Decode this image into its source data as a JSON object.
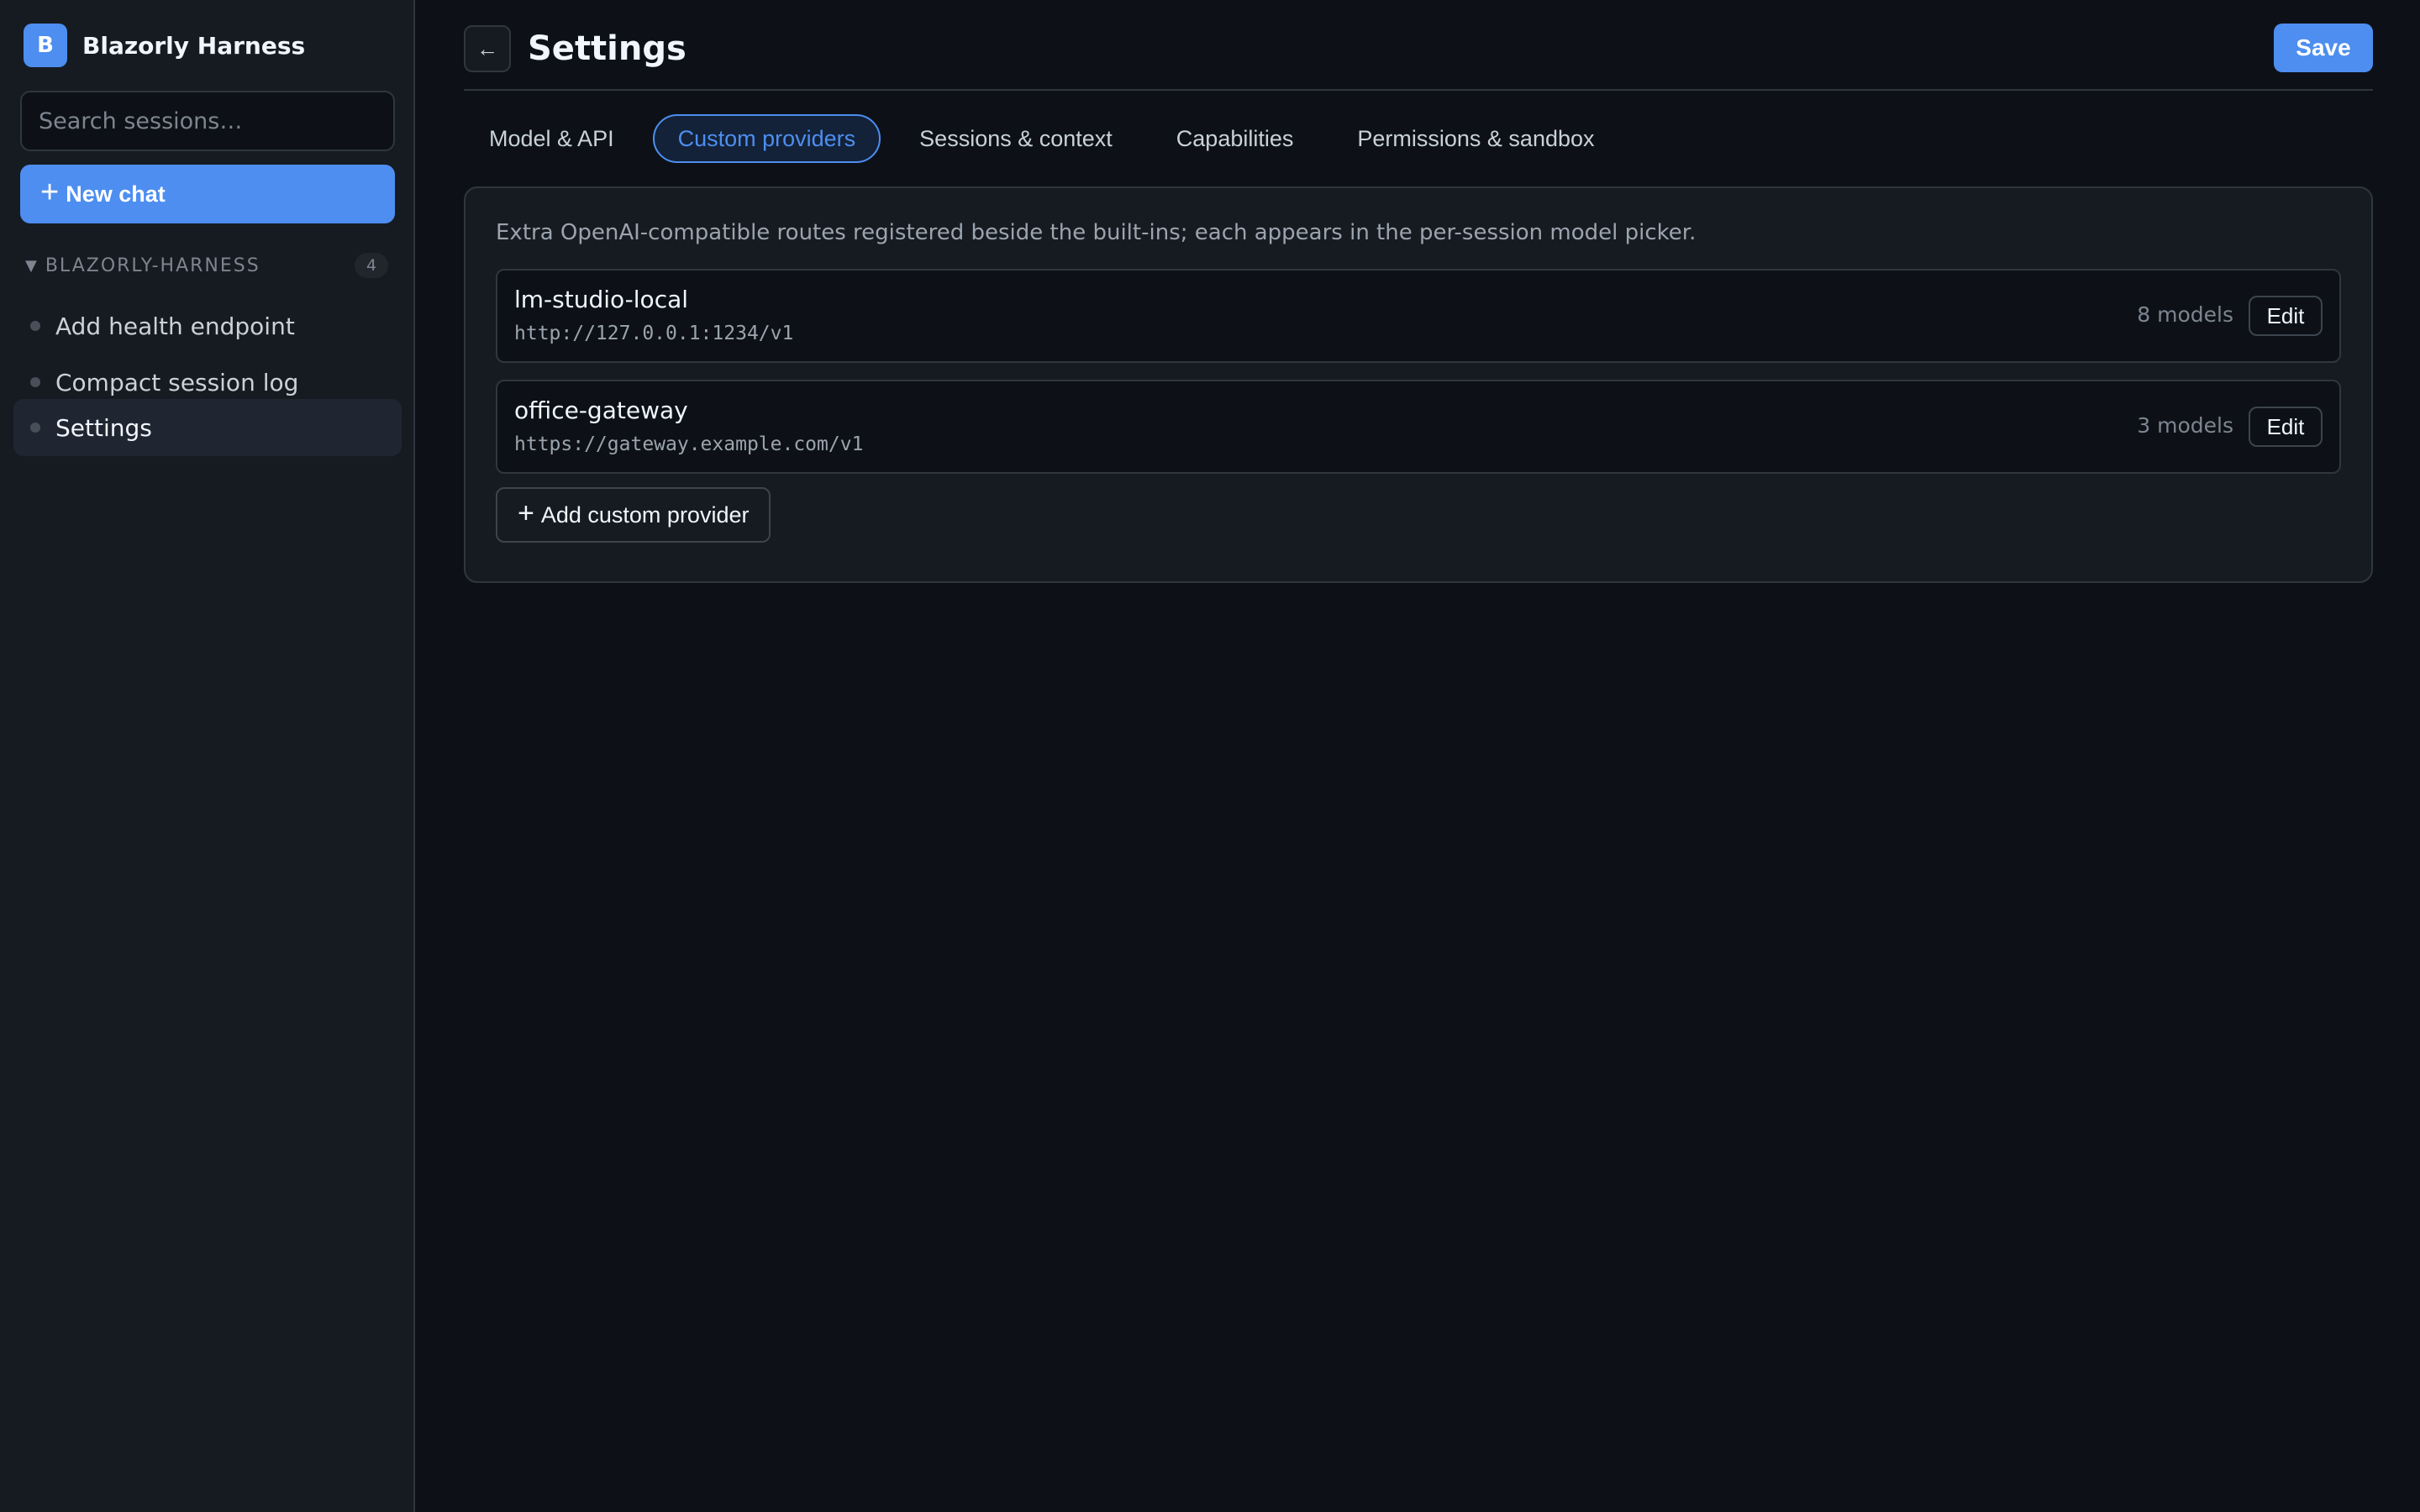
{
  "sidebar": {
    "brand_initial": "B",
    "brand_name": "Blazorly Harness",
    "search_placeholder": "Search sessions…",
    "new_chat_label": "New chat",
    "group": {
      "title": "BLAZORLY-HARNESS",
      "count": "4"
    },
    "items": [
      {
        "label": "Add health endpoint",
        "active": false
      },
      {
        "label": "Compact session log",
        "active": false
      },
      {
        "label": "Settings",
        "active": true
      }
    ]
  },
  "header": {
    "back_icon": "←",
    "title": "Settings",
    "save_label": "Save"
  },
  "tabs": [
    {
      "label": "Model & API",
      "active": false
    },
    {
      "label": "Custom providers",
      "active": true
    },
    {
      "label": "Sessions & context",
      "active": false
    },
    {
      "label": "Capabilities",
      "active": false
    },
    {
      "label": "Permissions & sandbox",
      "active": false
    }
  ],
  "panel": {
    "description": "Extra OpenAI-compatible routes registered beside the built-ins; each appears in the per-session model picker.",
    "providers": [
      {
        "name": "lm-studio-local",
        "url": "http://127.0.0.1:1234/v1",
        "models": "8 models",
        "edit_label": "Edit"
      },
      {
        "name": "office-gateway",
        "url": "https://gateway.example.com/v1",
        "models": "3 models",
        "edit_label": "Edit"
      }
    ],
    "add_label": "Add custom provider"
  },
  "colors": {
    "accent": "#4d8ef0",
    "background": "#0d1117",
    "surface": "#161b22",
    "border": "#30363d"
  }
}
